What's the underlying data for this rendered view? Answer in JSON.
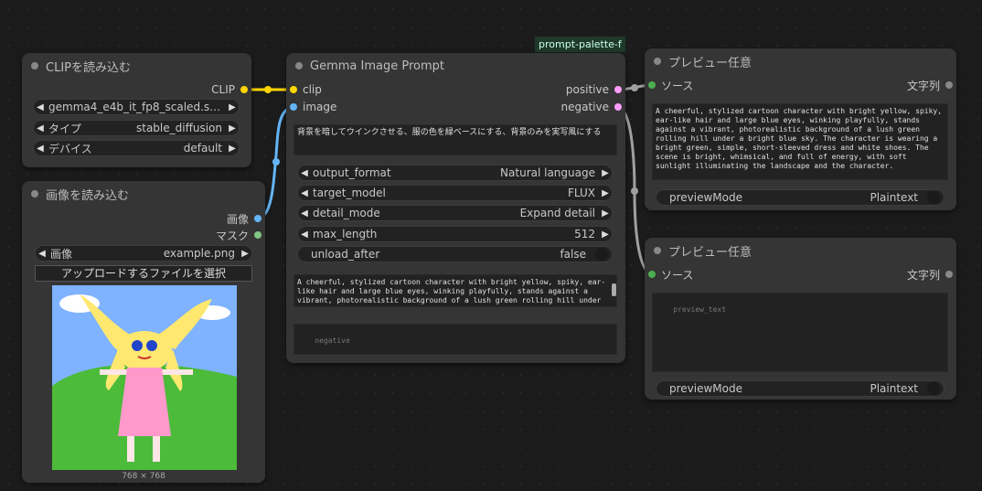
{
  "group_label": "prompt-palette-f",
  "clip_loader": {
    "title": "CLIPを読み込む",
    "output": "CLIP",
    "widgets": [
      {
        "label": "",
        "value": "gemma4_e4b_it_fp8_scaled.saf..."
      },
      {
        "label": "タイプ",
        "value": "stable_diffusion"
      },
      {
        "label": "デバイス",
        "value": "default"
      }
    ]
  },
  "image_loader": {
    "title": "画像を読み込む",
    "outputs": [
      "画像",
      "マスク"
    ],
    "image_widget": {
      "label": "画像",
      "value": "example.png"
    },
    "upload_button": "アップロードするファイルを選択",
    "size_caption": "768 × 768"
  },
  "gemma_prompt": {
    "title": "Gemma Image Prompt",
    "inputs": [
      "clip",
      "image"
    ],
    "outputs": [
      "positive",
      "negative"
    ],
    "instruction": "背景を暗してウインクさせる、服の色を緑ベースにする、背景のみを実写風にする",
    "widgets": [
      {
        "label": "output_format",
        "value": "Natural language"
      },
      {
        "label": "target_model",
        "value": "FLUX"
      },
      {
        "label": "detail_mode",
        "value": "Expand detail"
      },
      {
        "label": "max_length",
        "value": "512"
      },
      {
        "label": "unload_after",
        "value": "false"
      }
    ],
    "positive_text": "A cheerful, stylized cartoon character with bright yellow, spiky, ear-like hair and large blue eyes, winking playfully, stands against a vibrant, photorealistic background of a lush green rolling hill under a bright blue sky. The character is wearing a bright green, simple",
    "negative_placeholder": "negative"
  },
  "preview1": {
    "title": "プレビュー任意",
    "input": "ソース",
    "output": "文字列",
    "text": "A cheerful, stylized cartoon character with bright yellow, spiky, ear-like hair and large blue eyes, winking playfully, stands against a vibrant, photorealistic background of a lush green rolling hill under a bright blue sky. The character is wearing a bright green, simple, short-sleeved dress and white shoes. The scene is bright, whimsical, and full of energy, with soft sunlight illuminating the landscape and the character.",
    "mode_label": "previewMode",
    "mode_value": "Plaintext"
  },
  "preview2": {
    "title": "プレビュー任意",
    "input": "ソース",
    "output": "文字列",
    "placeholder": "preview_text",
    "mode_label": "previewMode",
    "mode_value": "Plaintext"
  },
  "colors": {
    "clip_link": "#ffd500",
    "image_link": "#64b5f6",
    "cond_link": "#a0a0a0",
    "node_bg": "#353535"
  }
}
